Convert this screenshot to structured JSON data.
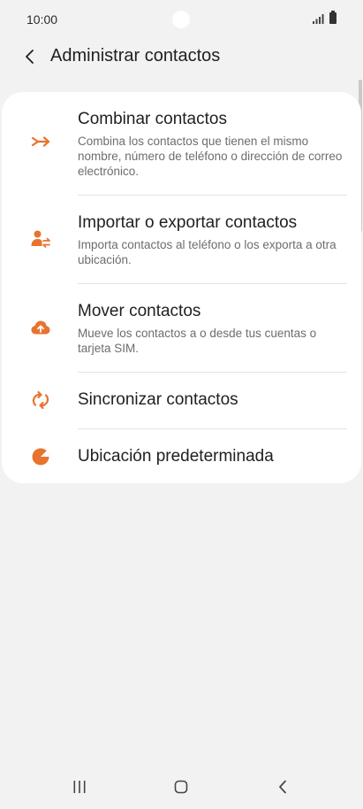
{
  "status_bar": {
    "time": "10:00",
    "icons": [
      "signal-icon",
      "battery-icon"
    ]
  },
  "header": {
    "title": "Administrar contactos",
    "back_icon": "chevron-left-icon"
  },
  "menu": {
    "items": [
      {
        "icon": "merge-arrows-icon",
        "title": "Combinar contactos",
        "description": "Combina los contactos que tienen el mismo nombre, número de teléfono o dirección de correo electrónico."
      },
      {
        "icon": "person-transfer-icon",
        "title": "Importar o exportar contactos",
        "description": "Importa contactos al teléfono o los exporta a otra ubicación."
      },
      {
        "icon": "cloud-upload-icon",
        "title": "Mover contactos",
        "description": "Mueve los contactos a o desde tus cuentas o tarjeta SIM."
      },
      {
        "icon": "sync-icon",
        "title": "Sincronizar contactos"
      },
      {
        "icon": "pie-chart-icon",
        "title": "Ubicación predeterminada"
      }
    ]
  },
  "nav_bar": {
    "buttons": [
      "recent-apps-icon",
      "home-icon",
      "back-icon"
    ]
  },
  "colors": {
    "accent": "#e8732f",
    "background": "#f2f2f2",
    "card": "#ffffff",
    "text_primary": "#1f1f1f",
    "text_secondary": "#6d6d6d"
  }
}
